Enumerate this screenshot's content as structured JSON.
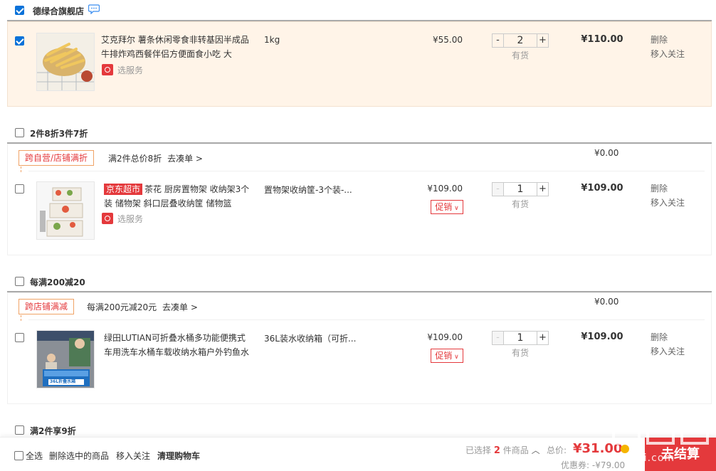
{
  "shop1": {
    "name": "德绿合旗舰店",
    "item": {
      "title": "艾克拜尔 薯条休闲零食非转基因半成品 牛排炸鸡西餐伴侣方便面食小吃 大",
      "service": "选服务",
      "spec": "1kg",
      "price": "¥55.00",
      "qty": "2",
      "stock": "有货",
      "subtotal": "¥110.00",
      "op_delete": "删除",
      "op_follow": "移入关注"
    }
  },
  "group2": {
    "name": "2件8折3件7折",
    "badge": "跨自营/店铺满折",
    "promo_text": "满2件总价8折",
    "promo_link": "去凑单 >",
    "amount": "¥0.00",
    "item": {
      "tag": "京东超市",
      "title": "茶花 厨房置物架 收纳架3个装 储物架 斜口层叠收纳筐 储物篮",
      "service": "选服务",
      "spec": "置物架收纳筐-3个装-...",
      "price": "¥109.00",
      "promo": "促销",
      "qty": "1",
      "stock": "有货",
      "subtotal": "¥109.00",
      "op_delete": "删除",
      "op_follow": "移入关注"
    }
  },
  "group3": {
    "name": "每满200减20",
    "badge": "跨店铺满减",
    "promo_text": "每满200元减20元",
    "promo_link": "去凑单 >",
    "amount": "¥0.00",
    "item": {
      "title": "绿田LUTIAN可折叠水桶多功能便携式车用洗车水桶车载收纳水箱户外钓鱼水",
      "spec": "36L装水收纳箱（可折...",
      "price": "¥109.00",
      "promo": "促销",
      "qty": "1",
      "stock": "有货",
      "subtotal": "¥109.00",
      "op_delete": "删除",
      "op_follow": "移入关注",
      "thumb_caption": "36L折叠水箱"
    }
  },
  "group4": {
    "name": "满2件享9折"
  },
  "footer": {
    "select_all": "全选",
    "delete_selected": "删除选中的商品",
    "move_follow": "移入关注",
    "clear_cart": "清理购物车",
    "selected_prefix": "已选择",
    "selected_count": "2",
    "selected_suffix": "件商品",
    "total_label": "总价:",
    "total_value": "¥31.00",
    "coupon": "优惠券: -¥79.00",
    "checkout": "去结算"
  },
  "watermark": "zhi zhi.com",
  "colors": {
    "accent": "#e4393c",
    "check": "#0a72d9",
    "selected_bg": "#fff4e8"
  }
}
